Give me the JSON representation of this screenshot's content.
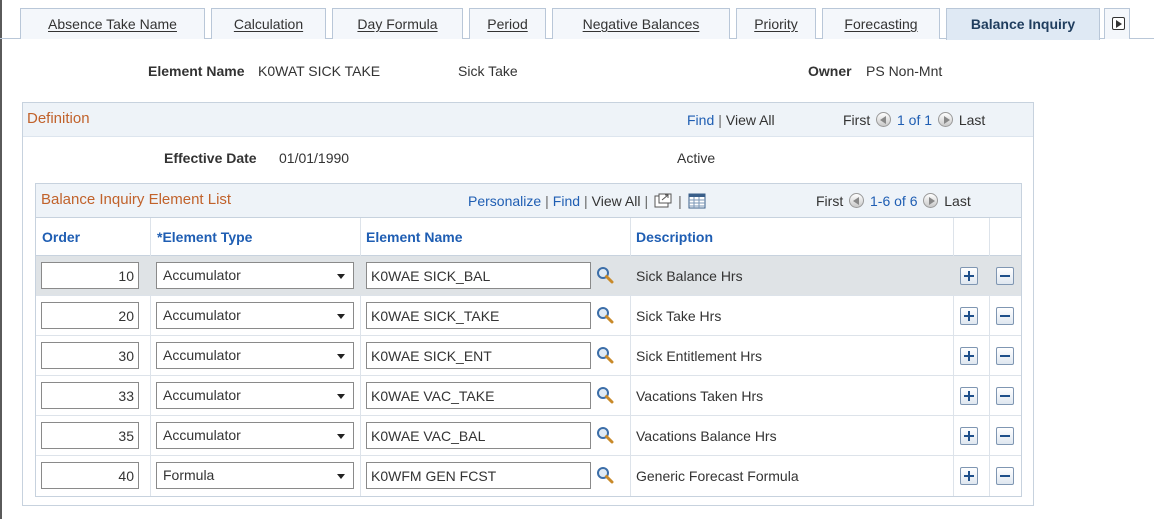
{
  "tabs": [
    {
      "label": "Absence Take Name"
    },
    {
      "label": "Calculation"
    },
    {
      "label": "Day Formula"
    },
    {
      "label": "Period"
    },
    {
      "label": "Negative Balances"
    },
    {
      "label": "Priority"
    },
    {
      "label": "Forecasting"
    },
    {
      "label": "Balance Inquiry",
      "active": true
    }
  ],
  "header": {
    "element_name_label": "Element Name",
    "element_name_value": "K0WAT SICK TAKE",
    "element_desc": "Sick Take",
    "owner_label": "Owner",
    "owner_value": "PS Non-Mnt"
  },
  "definition": {
    "title": "Definition",
    "find": "Find",
    "view_all": "View All",
    "first": "First",
    "count": "1 of 1",
    "last": "Last",
    "effective_date_label": "Effective Date",
    "effective_date_value": "01/01/1990",
    "status": "Active"
  },
  "grid": {
    "title": "Balance Inquiry Element List",
    "personalize": "Personalize",
    "find": "Find",
    "view_all": "View All",
    "first": "First",
    "count": "1-6 of 6",
    "last": "Last",
    "columns": {
      "order": "Order",
      "element_type": "*Element Type",
      "element_name": "Element Name",
      "description": "Description"
    },
    "rows": [
      {
        "order": "10",
        "type": "Accumulator",
        "name": "K0WAE SICK_BAL",
        "description": "Sick Balance Hrs"
      },
      {
        "order": "20",
        "type": "Accumulator",
        "name": "K0WAE SICK_TAKE",
        "description": "Sick Take Hrs"
      },
      {
        "order": "30",
        "type": "Accumulator",
        "name": "K0WAE SICK_ENT",
        "description": "Sick Entitlement Hrs"
      },
      {
        "order": "33",
        "type": "Accumulator",
        "name": "K0WAE VAC_TAKE",
        "description": "Vacations Taken Hrs"
      },
      {
        "order": "35",
        "type": "Accumulator",
        "name": "K0WAE VAC_BAL",
        "description": "Vacations Balance Hrs"
      },
      {
        "order": "40",
        "type": "Formula",
        "name": "K0WFM GEN FCST",
        "description": "Generic Forecast Formula"
      }
    ]
  },
  "icons": {
    "lookup": "magnifier-icon",
    "add_row": "plus-icon",
    "delete_row": "minus-icon",
    "zoom": "new-window-icon",
    "download": "spreadsheet-icon",
    "prev": "arrow-left-icon",
    "next": "arrow-right-icon",
    "tab_scroll": "arrow-right-icon"
  },
  "colors": {
    "link": "#1f5eb3",
    "section_title": "#c1622b",
    "header_bg": "#eef3f8",
    "selected_row": "#dfe3e6"
  }
}
